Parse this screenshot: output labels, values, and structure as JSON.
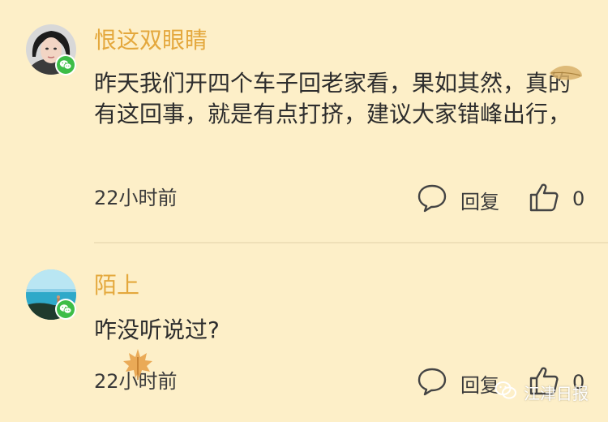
{
  "comments": [
    {
      "username": "恨这双眼睛",
      "text": "昨天我们开四个车子回老家看，果如其然，真的有这回事，就是有点打挤，建议大家错峰出行，",
      "time": "22小时前",
      "reply_label": "回复",
      "like_count": "0",
      "avatar_icon": "user-avatar",
      "badge_icon": "wechat-icon"
    },
    {
      "username": "陌上",
      "text": "咋没听说过?",
      "time": "22小时前",
      "reply_label": "回复",
      "like_count": "0",
      "avatar_icon": "user-avatar",
      "badge_icon": "wechat-icon"
    }
  ],
  "watermark": {
    "text": "江津日报",
    "icon": "wechat-icon"
  },
  "colors": {
    "background": "#fdefc8",
    "username": "#e4a83d",
    "wechat_green": "#3dbd47",
    "text": "#2d2d2d"
  }
}
